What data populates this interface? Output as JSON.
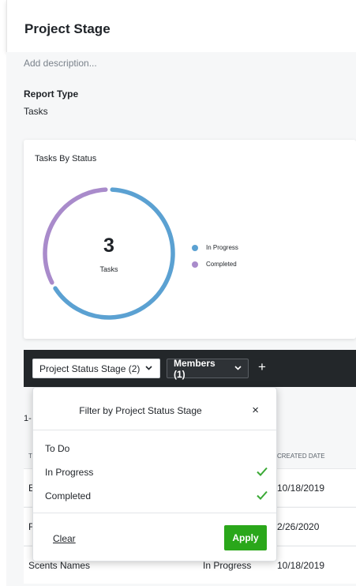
{
  "header": {
    "title": "Project Stage"
  },
  "description": {
    "placeholder": "Add description..."
  },
  "report": {
    "label": "Report Type",
    "value": "Tasks"
  },
  "chart_data": {
    "type": "pie",
    "title": "Tasks By Status",
    "center_value": "3",
    "center_label": "Tasks",
    "series": [
      {
        "name": "In Progress",
        "value": 2,
        "color": "#5ba1d2"
      },
      {
        "name": "Completed",
        "value": 1,
        "color": "#a98bcb"
      }
    ]
  },
  "filter_bar": {
    "stage_pill": "Project Status Stage (2)",
    "members_pill": "Members (1)",
    "add_symbol": "+"
  },
  "results": {
    "range_text": "1-"
  },
  "table": {
    "headers": [
      "T",
      "CREATED DATE"
    ],
    "rows": [
      {
        "name": "E",
        "status": "",
        "date": "10/18/2019"
      },
      {
        "name": "F",
        "status": "",
        "date": "2/26/2020"
      },
      {
        "name": "Scents Names",
        "status": "In Progress",
        "date": "10/18/2019"
      }
    ]
  },
  "dropdown": {
    "title": "Filter by Project Status Stage",
    "close_symbol": "×",
    "options": [
      {
        "label": "To Do",
        "checked": false
      },
      {
        "label": "In Progress",
        "checked": true
      },
      {
        "label": "Completed",
        "checked": true
      }
    ],
    "clear_label": "Clear",
    "apply_label": "Apply"
  },
  "colors": {
    "accent_green": "#2aa71a",
    "check_green": "#3aa935",
    "filter_bar_bg": "#23272a"
  },
  "icons": {
    "check": "check-icon",
    "chevron": "chevron-down-icon",
    "close": "close-icon",
    "add": "plus-icon"
  }
}
